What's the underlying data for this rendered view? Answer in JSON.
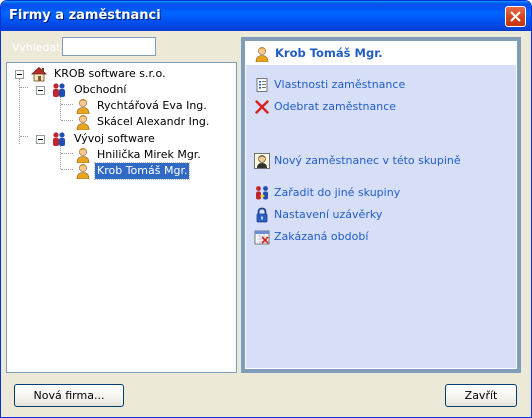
{
  "window": {
    "title": "Firmy a zaměstnanci"
  },
  "search": {
    "label": "Vyhledat:",
    "value": ""
  },
  "tree": {
    "company": "KROB software s.r.o.",
    "groups": [
      {
        "name": "Obchodní",
        "employees": [
          "Rychtářová Eva Ing.",
          "Skácel Alexandr Ing."
        ]
      },
      {
        "name": "Vývoj software",
        "employees": [
          "Hnilička Mirek Mgr.",
          "Krob Tomáš Mgr."
        ]
      }
    ],
    "selected": "Krob Tomáš Mgr."
  },
  "panel": {
    "title": "Krob Tomáš Mgr.",
    "actions": {
      "properties": "Vlastnosti zaměstnance",
      "remove": "Odebrat zaměstnance",
      "new_in_group": "Nový zaměstnanec v této skupině",
      "move_group": "Zařadit do jiné skupiny",
      "lock_settings": "Nastavení uzávěrky",
      "forbidden_periods": "Zakázaná období"
    }
  },
  "buttons": {
    "new_company": "Nová firma...",
    "close": "Zavřít"
  },
  "colors": {
    "titlebar": "#0055ea",
    "panel_bg": "#d6dff7",
    "link": "#215dc6",
    "selection": "#316ac5"
  }
}
